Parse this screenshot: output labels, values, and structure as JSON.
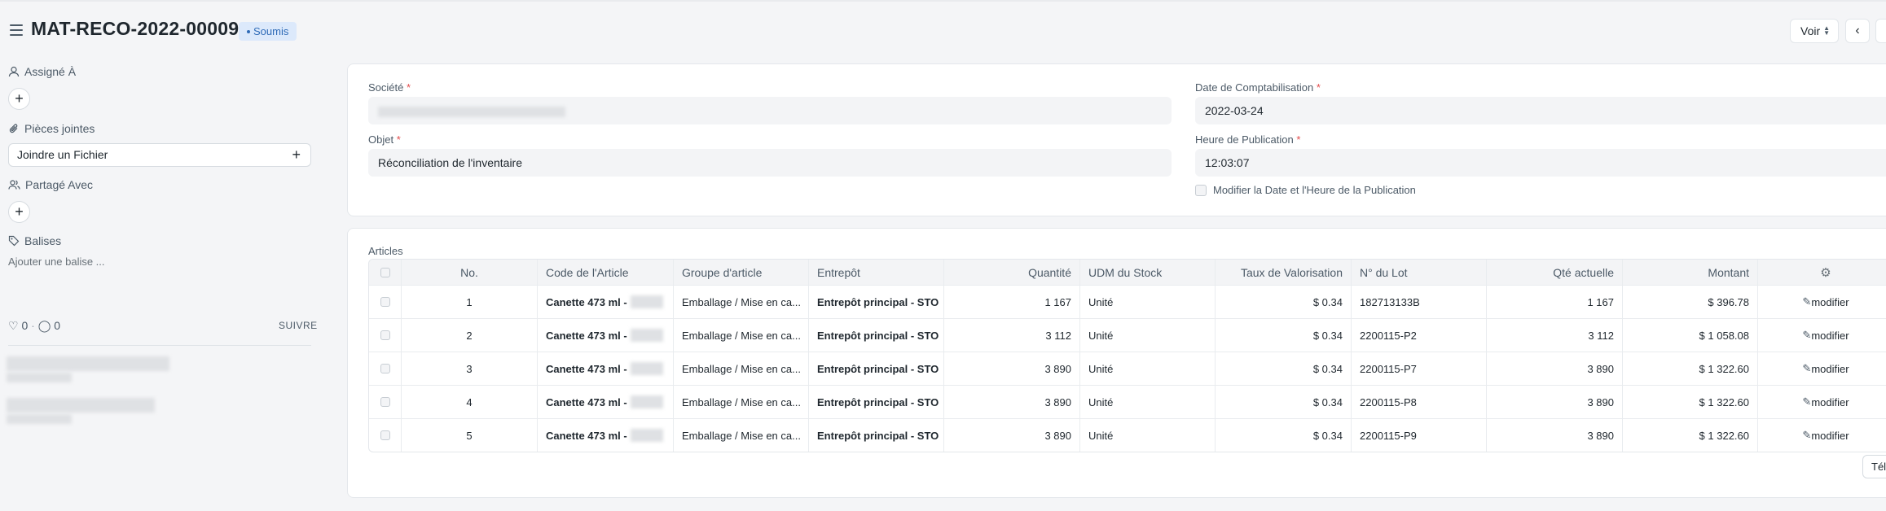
{
  "header": {
    "title": "MAT-RECO-2022-00009",
    "status": "Soumis",
    "view_label": "Voir",
    "prev_label": "‹",
    "next_label": "›"
  },
  "sidebar": {
    "assigned_label": "Assigné À",
    "attachments_label": "Pièces jointes",
    "attach_button": "Joindre un Fichier",
    "shared_label": "Partagé Avec",
    "tags_label": "Balises",
    "add_tag": "Ajouter une balise ...",
    "likes": "0",
    "comments": "0",
    "follow": "SUIVRE"
  },
  "form": {
    "company_label": "Société",
    "company_value": "",
    "posting_date_label": "Date de Comptabilisation",
    "posting_date_value": "2022-03-24",
    "purpose_label": "Objet",
    "purpose_value": "Réconciliation de l'inventaire",
    "posting_time_label": "Heure de Publication",
    "posting_time_value": "12:03:07",
    "edit_posting_label": "Modifier la Date et l'Heure de la Publication"
  },
  "items": {
    "title": "Articles",
    "columns": [
      "No.",
      "Code de l'Article",
      "Groupe d'article",
      "Entrepôt",
      "Quantité",
      "UDM du Stock",
      "Taux de Valorisation",
      "N° du Lot",
      "Qté actuelle",
      "Montant"
    ],
    "rows": [
      {
        "no": "1",
        "code": "Canette 473 ml -",
        "group": "Emballage / Mise en ca...",
        "warehouse": "Entrepôt principal - STO",
        "qty": "1 167",
        "uom": "Unité",
        "rate": "$ 0.34",
        "batch": "182713133B",
        "current_qty": "1 167",
        "amount": "$ 396.78",
        "edit": "modifier"
      },
      {
        "no": "2",
        "code": "Canette 473 ml -",
        "group": "Emballage / Mise en ca...",
        "warehouse": "Entrepôt principal - STO",
        "qty": "3 112",
        "uom": "Unité",
        "rate": "$ 0.34",
        "batch": "2200115-P2",
        "current_qty": "3 112",
        "amount": "$ 1 058.08",
        "edit": "modifier"
      },
      {
        "no": "3",
        "code": "Canette 473 ml -",
        "group": "Emballage / Mise en ca...",
        "warehouse": "Entrepôt principal - STO",
        "qty": "3 890",
        "uom": "Unité",
        "rate": "$ 0.34",
        "batch": "2200115-P7",
        "current_qty": "3 890",
        "amount": "$ 1 322.60",
        "edit": "modifier"
      },
      {
        "no": "4",
        "code": "Canette 473 ml -",
        "group": "Emballage / Mise en ca...",
        "warehouse": "Entrepôt principal - STO",
        "qty": "3 890",
        "uom": "Unité",
        "rate": "$ 0.34",
        "batch": "2200115-P8",
        "current_qty": "3 890",
        "amount": "$ 1 322.60",
        "edit": "modifier"
      },
      {
        "no": "5",
        "code": "Canette 473 ml -",
        "group": "Emballage / Mise en ca...",
        "warehouse": "Entrepôt principal - STO",
        "qty": "3 890",
        "uom": "Unité",
        "rate": "$ 0.34",
        "batch": "2200115-P9",
        "current_qty": "3 890",
        "amount": "$ 1 322.60",
        "edit": "modifier"
      }
    ],
    "download_label": "Télécharger"
  }
}
